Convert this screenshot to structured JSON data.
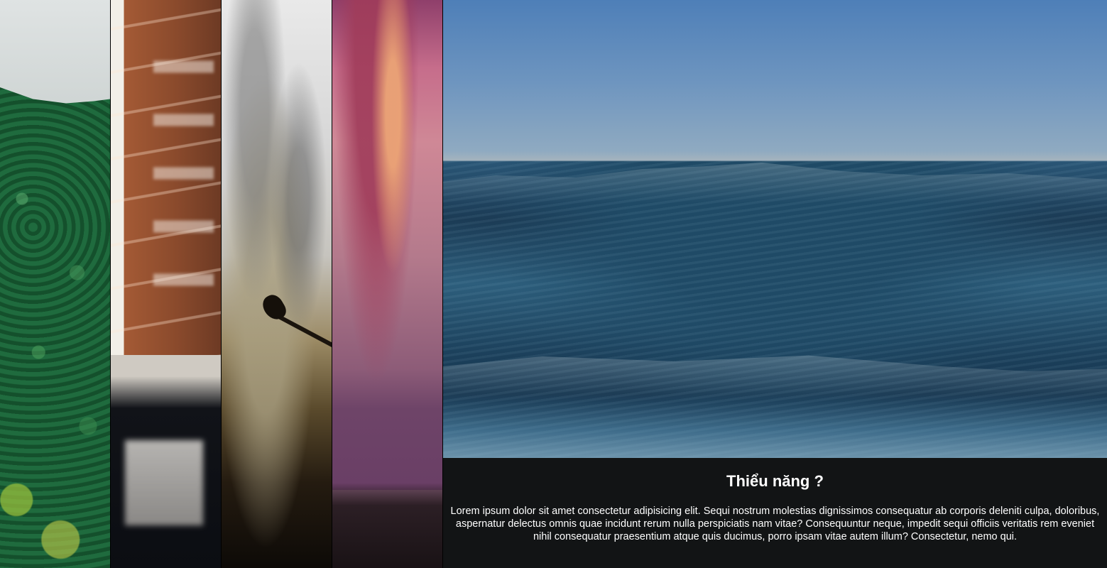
{
  "panels": [
    {
      "id": "forest",
      "alt": ""
    },
    {
      "id": "building",
      "alt": ""
    },
    {
      "id": "smoke",
      "alt": ""
    },
    {
      "id": "sunset",
      "alt": ""
    },
    {
      "id": "ocean",
      "alt": ""
    }
  ],
  "active_panel": {
    "title": "Thiểu năng ?",
    "description": "Lorem ipsum dolor sit amet consectetur adipisicing elit. Sequi nostrum molestias dignissimos consequatur ab corporis deleniti culpa, doloribus, aspernatur delectus omnis quae incidunt rerum nulla perspiciatis nam vitae? Consequuntur neque, impedit sequi officiis veritatis rem eveniet nihil consequatur praesentium atque quis ducimus, porro ipsam vitae autem illum? Consectetur, nemo qui."
  }
}
